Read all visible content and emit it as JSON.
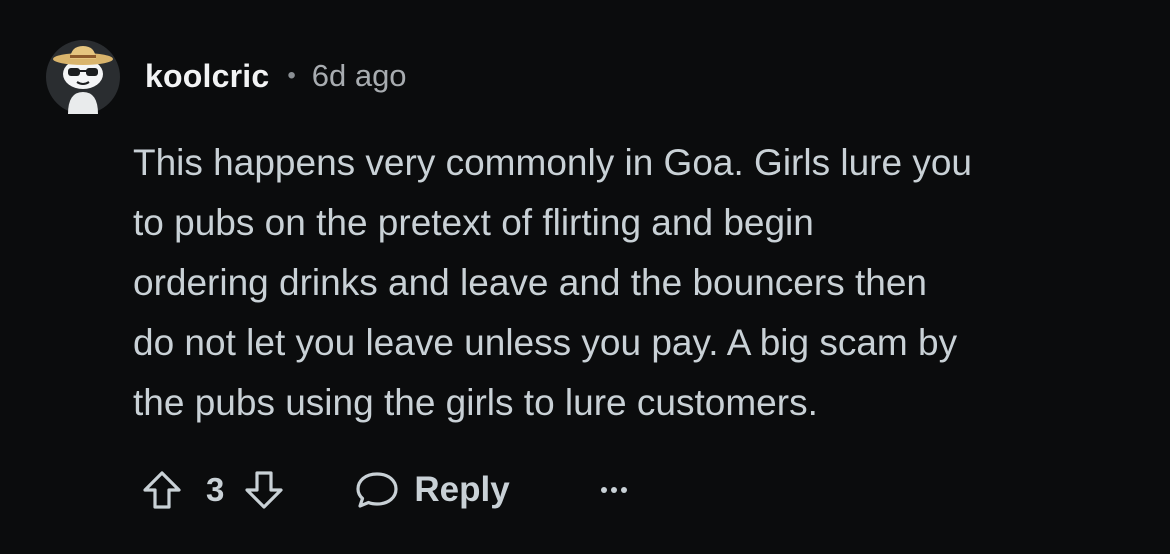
{
  "comment": {
    "username": "koolcric",
    "separator": "•",
    "timestamp": "6d ago",
    "body_lines": [
      "This happens very commonly in Goa. Girls lure you",
      "to pubs on the pretext of flirting and begin",
      "ordering drinks and leave and the bouncers then",
      "do not let you leave unless you pay. A big scam by",
      "the pubs using the girls to lure customers."
    ],
    "vote_count": "3",
    "reply_label": "Reply",
    "avatar_icon": "snoo-avatar-with-hat-and-sunglasses",
    "upvote_icon": "upvote-arrow-icon",
    "downvote_icon": "downvote-arrow-icon",
    "reply_icon": "speech-bubble-icon",
    "more_icon": "ellipsis-icon"
  },
  "colors": {
    "background": "#0b0c0d",
    "username": "#f2f3f4",
    "body_text": "#c9d1d6",
    "muted": "#a8acb0"
  }
}
